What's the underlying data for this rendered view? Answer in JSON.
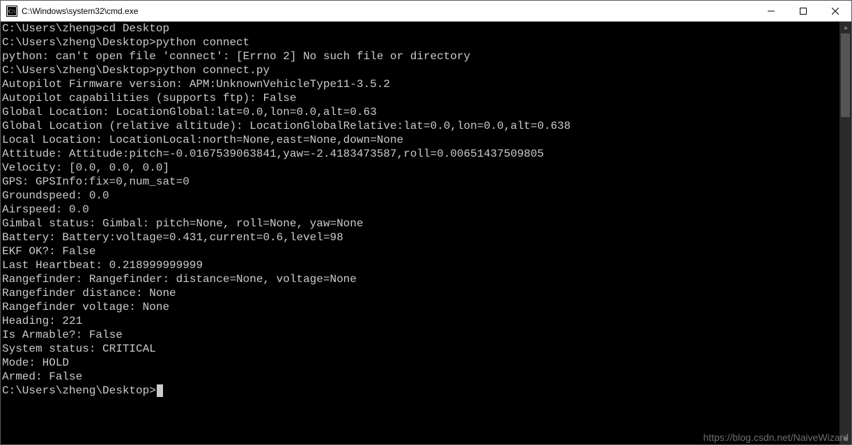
{
  "window": {
    "title": "C:\\Windows\\system32\\cmd.exe"
  },
  "terminal": {
    "lines": [
      {
        "prompt": "C:\\Users\\zheng>",
        "cmd": "cd Desktop"
      },
      {
        "text": ""
      },
      {
        "prompt": "C:\\Users\\zheng\\Desktop>",
        "cmd": "python connect"
      },
      {
        "text": "python: can't open file 'connect': [Errno 2] No such file or directory"
      },
      {
        "text": ""
      },
      {
        "prompt": "C:\\Users\\zheng\\Desktop>",
        "cmd": "python connect.py"
      },
      {
        "text": "Autopilot Firmware version: APM:UnknownVehicleType11-3.5.2"
      },
      {
        "text": "Autopilot capabilities (supports ftp): False"
      },
      {
        "text": "Global Location: LocationGlobal:lat=0.0,lon=0.0,alt=0.63"
      },
      {
        "text": "Global Location (relative altitude): LocationGlobalRelative:lat=0.0,lon=0.0,alt=0.638"
      },
      {
        "text": "Local Location: LocationLocal:north=None,east=None,down=None"
      },
      {
        "text": "Attitude: Attitude:pitch=-0.0167539063841,yaw=-2.4183473587,roll=0.00651437509805"
      },
      {
        "text": "Velocity: [0.0, 0.0, 0.0]"
      },
      {
        "text": "GPS: GPSInfo:fix=0,num_sat=0"
      },
      {
        "text": "Groundspeed: 0.0"
      },
      {
        "text": "Airspeed: 0.0"
      },
      {
        "text": "Gimbal status: Gimbal: pitch=None, roll=None, yaw=None"
      },
      {
        "text": "Battery: Battery:voltage=0.431,current=0.6,level=98"
      },
      {
        "text": "EKF OK?: False"
      },
      {
        "text": "Last Heartbeat: 0.218999999999"
      },
      {
        "text": "Rangefinder: Rangefinder: distance=None, voltage=None"
      },
      {
        "text": "Rangefinder distance: None"
      },
      {
        "text": "Rangefinder voltage: None"
      },
      {
        "text": "Heading: 221"
      },
      {
        "text": "Is Armable?: False"
      },
      {
        "text": "System status: CRITICAL"
      },
      {
        "text": "Mode: HOLD"
      },
      {
        "text": "Armed: False"
      },
      {
        "text": ""
      },
      {
        "prompt": "C:\\Users\\zheng\\Desktop>",
        "cmd": "",
        "cursor": true
      }
    ]
  },
  "watermark": "https://blog.csdn.net/NaiveWizard"
}
